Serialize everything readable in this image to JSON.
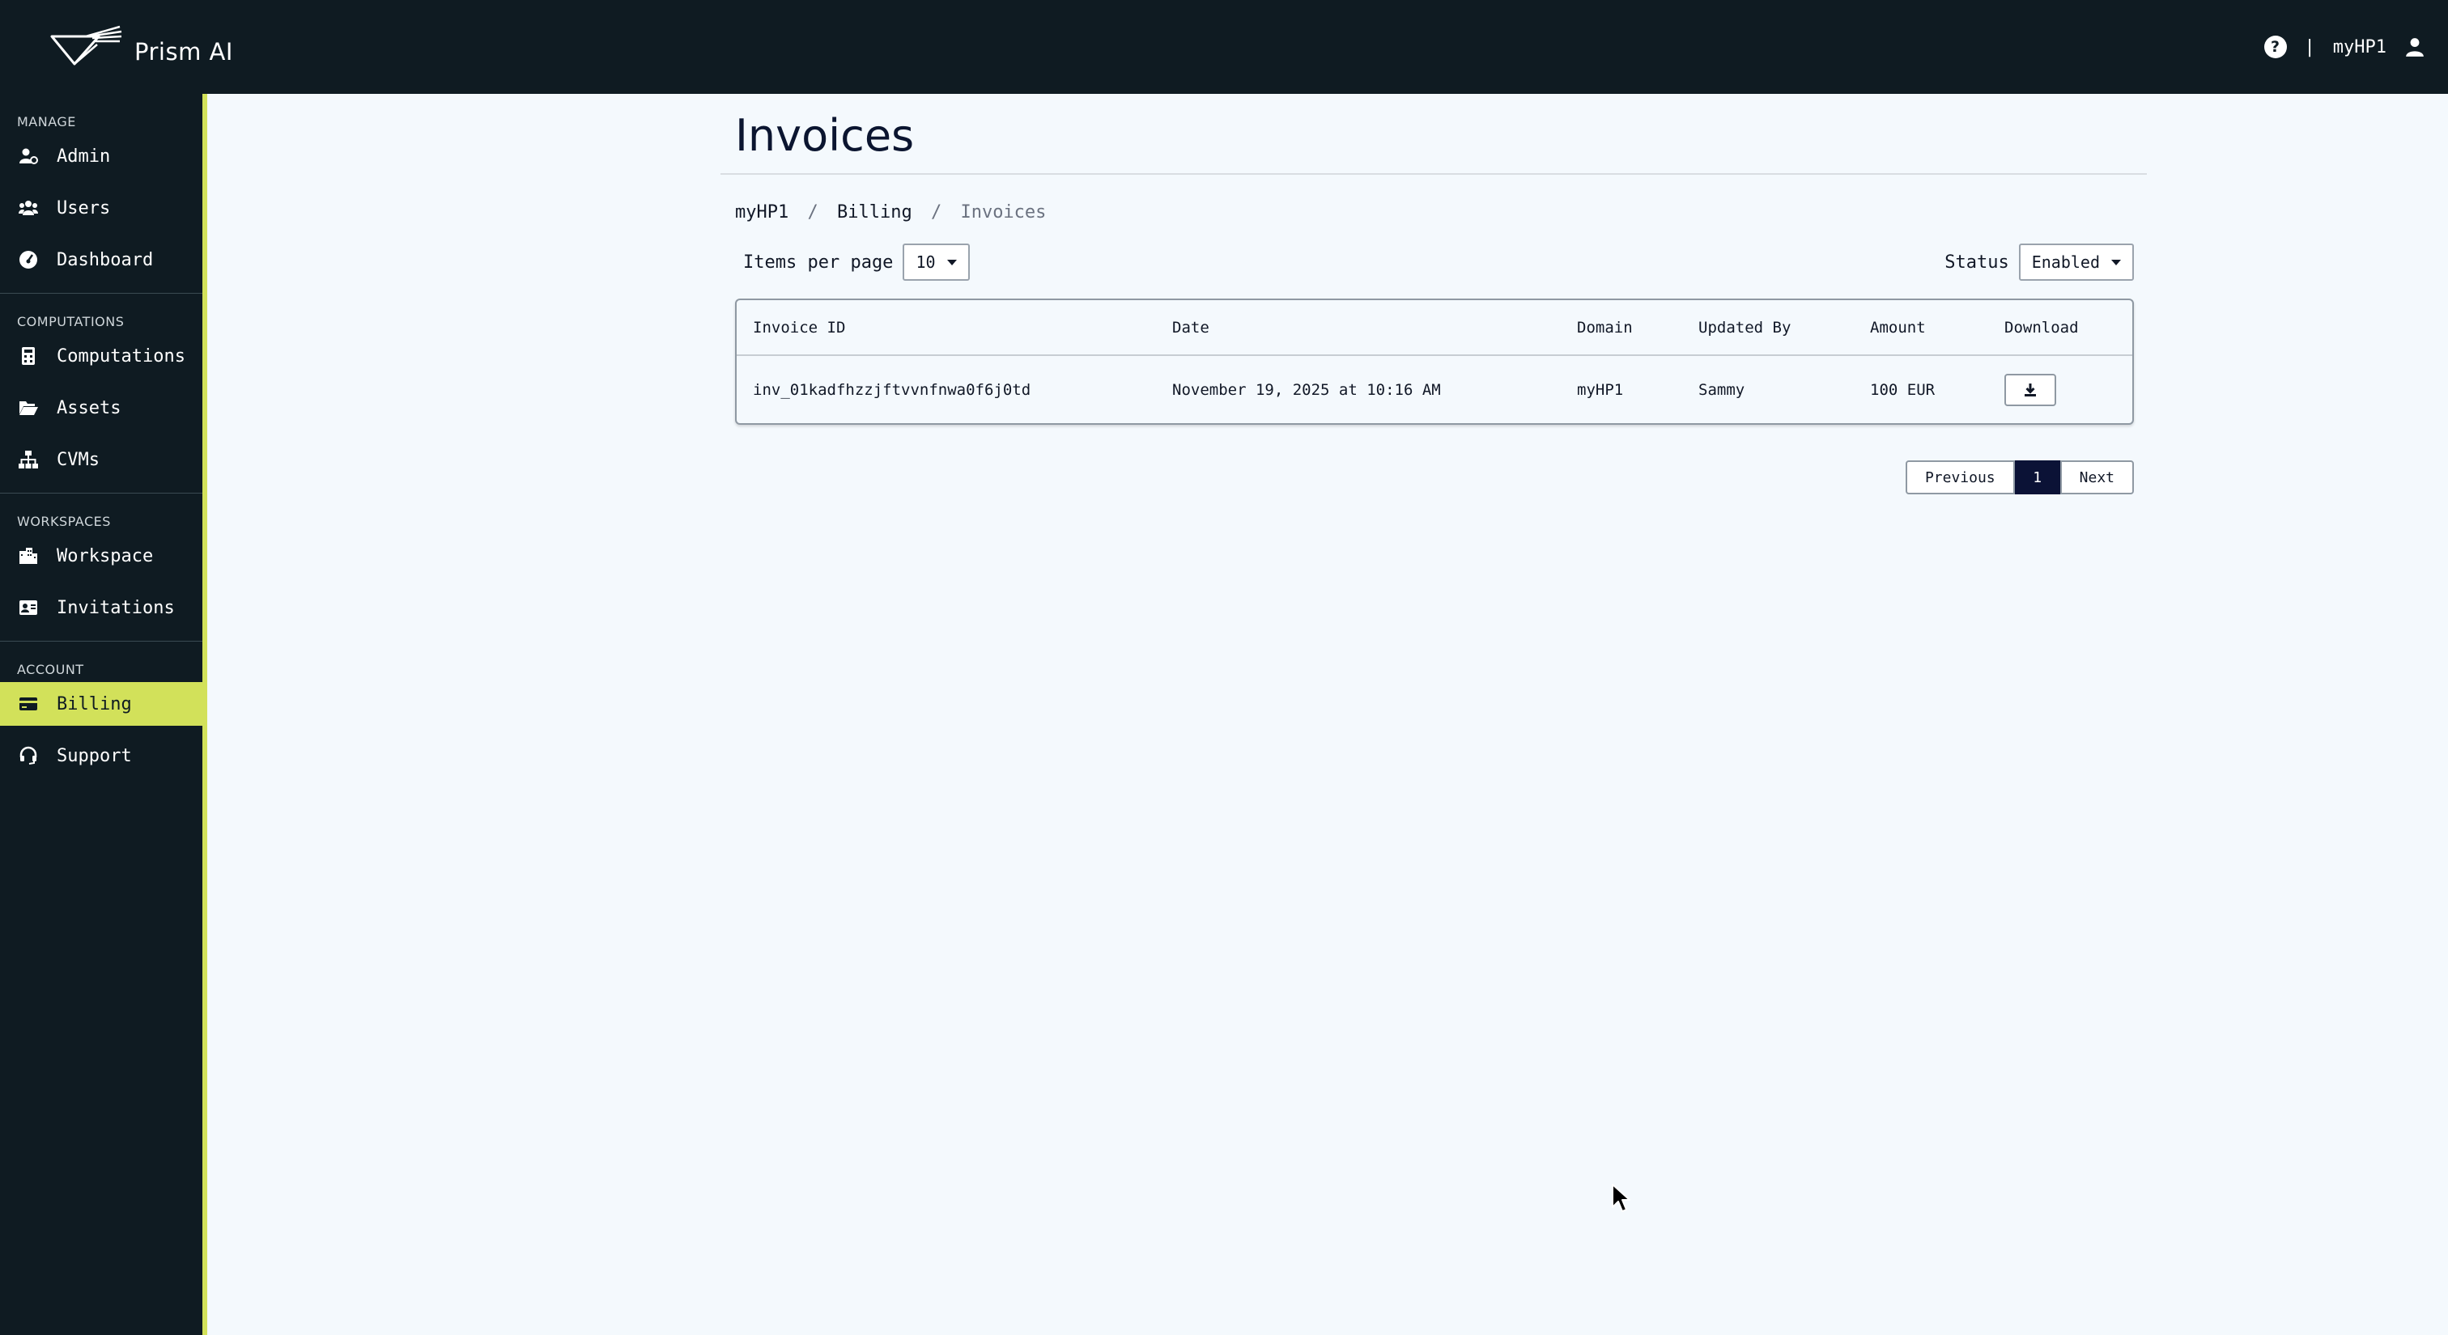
{
  "app": {
    "name": "Prism AI"
  },
  "header": {
    "username": "myHP1",
    "separator": "|",
    "help_glyph": "?"
  },
  "sidebar": {
    "sections": [
      {
        "title": "MANAGE",
        "items": [
          {
            "label": "Admin",
            "icon": "user-gear-icon"
          },
          {
            "label": "Users",
            "icon": "users-icon"
          },
          {
            "label": "Dashboard",
            "icon": "gauge-icon"
          }
        ]
      },
      {
        "title": "COMPUTATIONS",
        "items": [
          {
            "label": "Computations",
            "icon": "calculator-icon"
          },
          {
            "label": "Assets",
            "icon": "folder-open-icon"
          },
          {
            "label": "CVMs",
            "icon": "sitemap-icon"
          }
        ]
      },
      {
        "title": "WORKSPACES",
        "items": [
          {
            "label": "Workspace",
            "icon": "building-icon"
          },
          {
            "label": "Invitations",
            "icon": "id-card-icon"
          }
        ]
      },
      {
        "title": "ACCOUNT",
        "items": [
          {
            "label": "Billing",
            "icon": "credit-card-icon",
            "active": true
          },
          {
            "label": "Support",
            "icon": "headset-icon"
          }
        ]
      }
    ]
  },
  "page": {
    "title": "Invoices",
    "breadcrumb": [
      "myHP1",
      "Billing",
      "Invoices"
    ],
    "breadcrumb_sep": "/",
    "items_per_page_label": "Items per page",
    "items_per_page_value": "10",
    "status_label": "Status",
    "status_value": "Enabled"
  },
  "table": {
    "columns": [
      "Invoice ID",
      "Date",
      "Domain",
      "Updated By",
      "Amount",
      "Download"
    ],
    "rows": [
      {
        "invoice_id": "inv_01kadfhzzjftvvnfnwa0f6j0td",
        "date": "November 19, 2025 at 10:16 AM",
        "domain": "myHP1",
        "updated_by": "Sammy",
        "amount": "100 EUR"
      }
    ]
  },
  "pagination": {
    "previous": "Previous",
    "page": "1",
    "next": "Next"
  },
  "colors": {
    "sidebar_bg": "#0f1b22",
    "accent": "#d2e15a",
    "page_bg": "#f4f9fd",
    "active_page": "#0b1236"
  }
}
